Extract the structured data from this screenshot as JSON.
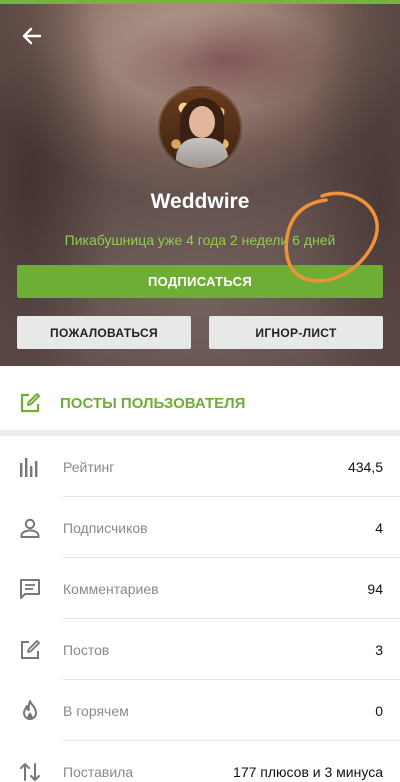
{
  "profile": {
    "username": "Weddwire",
    "since": "Пикабушница уже 4 года 2 недели 6 дней",
    "accent_color": "#6fae35"
  },
  "actions": {
    "subscribe": "ПОДПИСАТЬСЯ",
    "report": "ПОЖАЛОВАТЬСЯ",
    "ignore": "ИГНОР-ЛИСТ"
  },
  "posts_link": {
    "label": "ПОСТЫ ПОЛЬЗОВАТЕЛЯ",
    "icon": "edit-icon"
  },
  "stats": [
    {
      "label": "Рейтинг",
      "value": "434,5",
      "icon": "bar-chart-icon"
    },
    {
      "label": "Подписчиков",
      "value": "4",
      "icon": "person-icon"
    },
    {
      "label": "Комментариев",
      "value": "94",
      "icon": "comment-icon"
    },
    {
      "label": "Постов",
      "value": "3",
      "icon": "edit-icon"
    },
    {
      "label": "В горячем",
      "value": "0",
      "icon": "flame-icon"
    },
    {
      "label": "Поставила",
      "value": "177 плюсов и 3 минуса",
      "icon": "sort-arrows-icon"
    }
  ]
}
